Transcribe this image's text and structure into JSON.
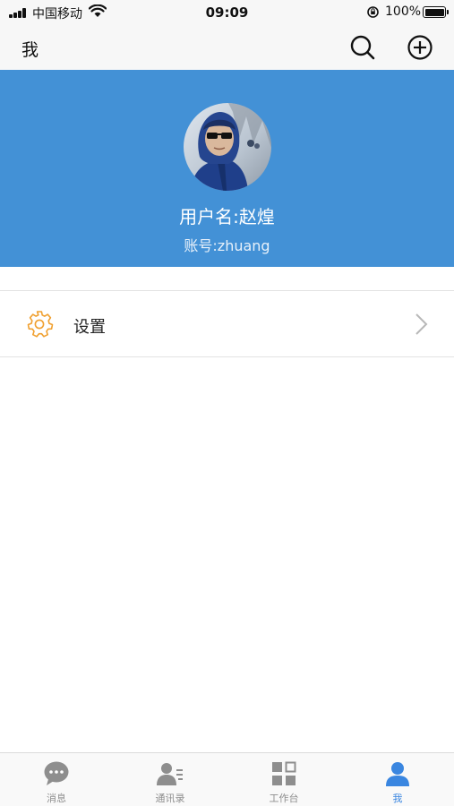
{
  "status_bar": {
    "carrier": "中国移动",
    "time": "09:09",
    "battery": "100%"
  },
  "nav": {
    "title": "我"
  },
  "profile": {
    "username": "用户名:赵煌",
    "account": "账号:zhuang"
  },
  "menu": {
    "settings_label": "设置"
  },
  "tabs": [
    {
      "label": "消息",
      "icon": "chat-bubble-icon"
    },
    {
      "label": "通讯录",
      "icon": "contacts-icon"
    },
    {
      "label": "工作台",
      "icon": "workbench-grid-icon"
    },
    {
      "label": "我",
      "icon": "person-icon"
    }
  ],
  "colors": {
    "header_blue": "#4391d6",
    "settings_icon_orange": "#f0a030",
    "tab_active": "#3a86e0",
    "tab_inactive": "#8e8e8e"
  }
}
